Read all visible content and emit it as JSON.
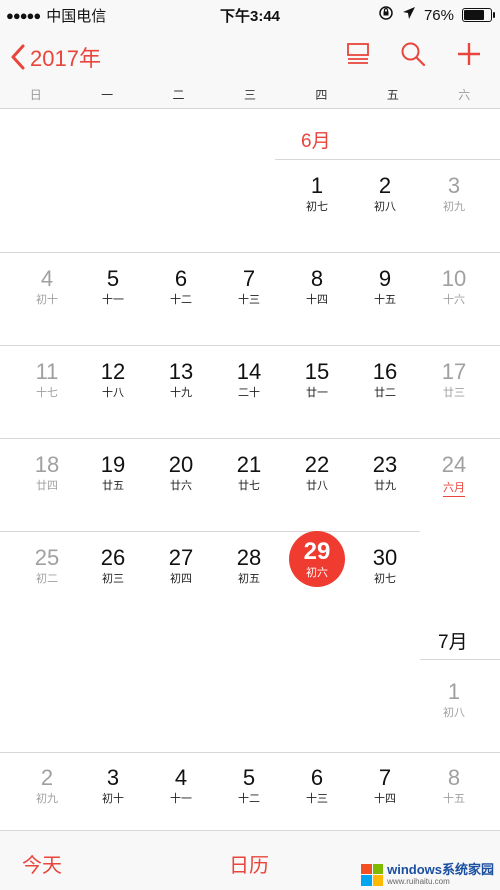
{
  "status": {
    "carrier": "中国电信",
    "time": "下午3:44",
    "battery": "76%",
    "battery_level": 0.76
  },
  "nav": {
    "back_label": "2017年",
    "icons": [
      "list-view-icon",
      "search-icon",
      "add-icon"
    ]
  },
  "weekdays": [
    "日",
    "一",
    "二",
    "三",
    "四",
    "五",
    "六"
  ],
  "months": {
    "june": "6月",
    "july": "7月"
  },
  "rows": [
    [
      null,
      null,
      null,
      null,
      {
        "d": "1",
        "l": "初七"
      },
      {
        "d": "2",
        "l": "初八"
      },
      {
        "d": "3",
        "l": "初九"
      }
    ],
    [
      {
        "d": "4",
        "l": "初十"
      },
      {
        "d": "5",
        "l": "十一"
      },
      {
        "d": "6",
        "l": "十二"
      },
      {
        "d": "7",
        "l": "十三"
      },
      {
        "d": "8",
        "l": "十四"
      },
      {
        "d": "9",
        "l": "十五"
      },
      {
        "d": "10",
        "l": "十六"
      }
    ],
    [
      {
        "d": "11",
        "l": "十七"
      },
      {
        "d": "12",
        "l": "十八"
      },
      {
        "d": "13",
        "l": "十九"
      },
      {
        "d": "14",
        "l": "二十"
      },
      {
        "d": "15",
        "l": "廿一"
      },
      {
        "d": "16",
        "l": "廿二"
      },
      {
        "d": "17",
        "l": "廿三"
      }
    ],
    [
      {
        "d": "18",
        "l": "廿四"
      },
      {
        "d": "19",
        "l": "廿五"
      },
      {
        "d": "20",
        "l": "廿六"
      },
      {
        "d": "21",
        "l": "廿七"
      },
      {
        "d": "22",
        "l": "廿八"
      },
      {
        "d": "23",
        "l": "廿九"
      },
      {
        "d": "24",
        "l": "六月"
      }
    ],
    [
      {
        "d": "25",
        "l": "初二"
      },
      {
        "d": "26",
        "l": "初三"
      },
      {
        "d": "27",
        "l": "初四"
      },
      {
        "d": "28",
        "l": "初五"
      },
      {
        "d": "29",
        "l": "初六"
      },
      {
        "d": "30",
        "l": "初七"
      },
      null
    ],
    [
      null,
      null,
      null,
      null,
      null,
      null,
      {
        "d": "1",
        "l": "初八"
      }
    ],
    [
      {
        "d": "2",
        "l": "初九"
      },
      {
        "d": "3",
        "l": "初十"
      },
      {
        "d": "4",
        "l": "十一"
      },
      {
        "d": "5",
        "l": "十二"
      },
      {
        "d": "6",
        "l": "十三"
      },
      {
        "d": "7",
        "l": "十四"
      },
      {
        "d": "8",
        "l": "十五"
      }
    ]
  ],
  "today": {
    "row": 4,
    "col": 4
  },
  "lunar_month_start": {
    "row": 3,
    "col": 6
  },
  "tabs": {
    "today_label": "今天",
    "calendar_label": "日历"
  },
  "watermark": {
    "title": "windows系统家园",
    "sub": "www.ruihaitu.com"
  },
  "colors": {
    "accent": "#e8453c",
    "today_fill": "#ef3b30",
    "weekend_text": "#a0a0a0"
  }
}
